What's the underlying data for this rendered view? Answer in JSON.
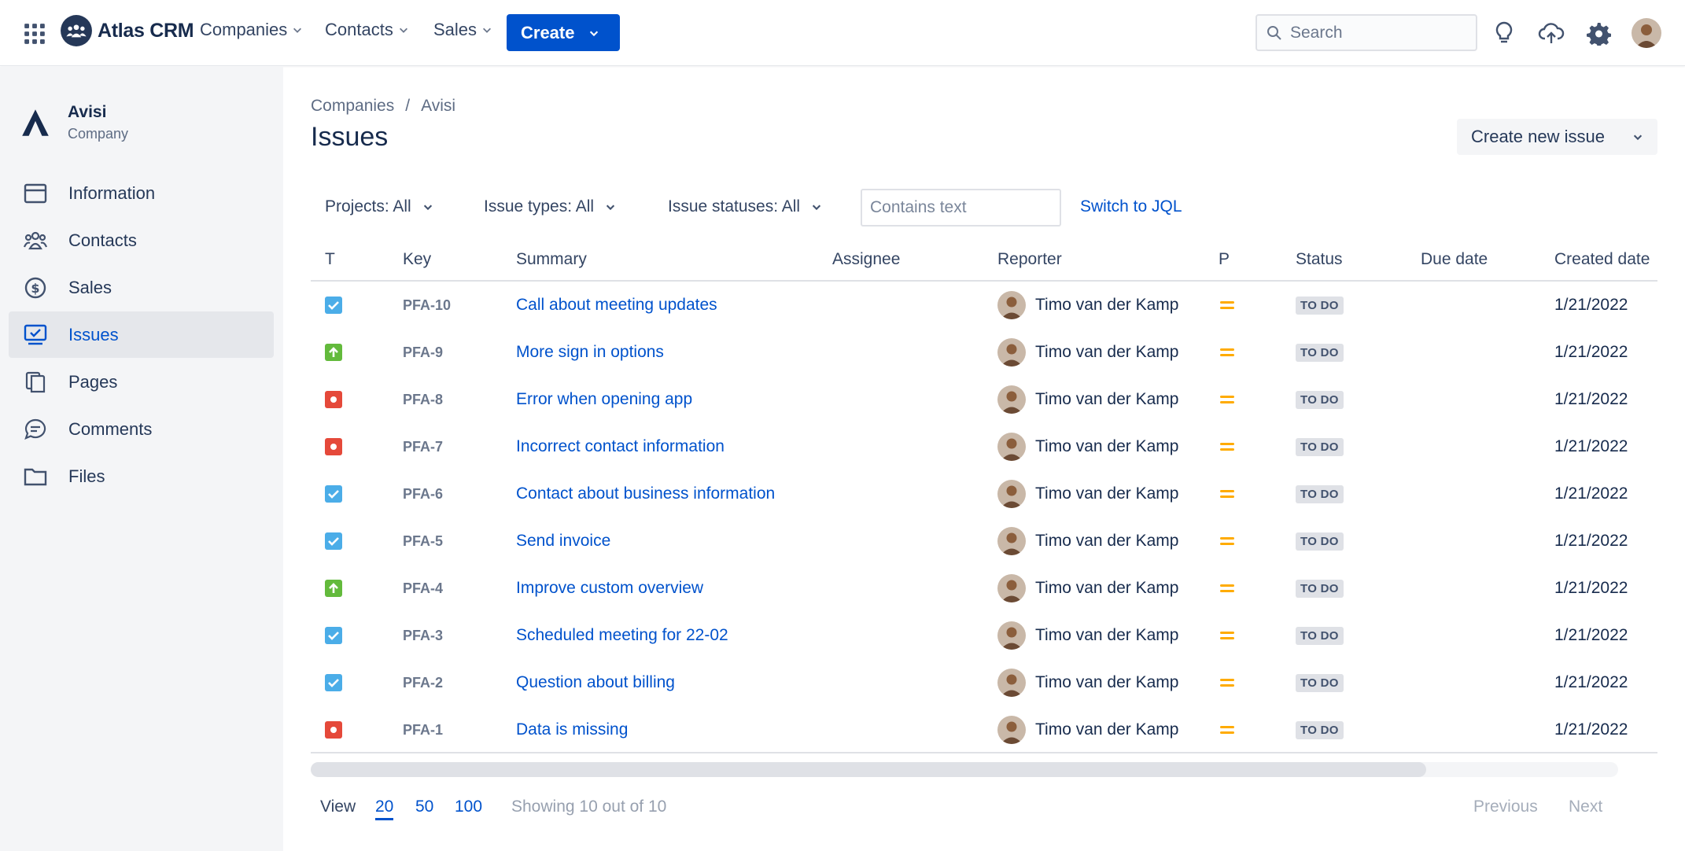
{
  "brand": {
    "name": "Atlas CRM"
  },
  "topnav": {
    "menus": [
      {
        "label": "Companies"
      },
      {
        "label": "Contacts"
      },
      {
        "label": "Sales"
      }
    ],
    "create_label": "Create",
    "search_placeholder": "Search"
  },
  "sidebar": {
    "company_name": "Avisi",
    "company_type": "Company",
    "items": [
      {
        "label": "Information",
        "icon": "browser-window-icon"
      },
      {
        "label": "Contacts",
        "icon": "people-icon"
      },
      {
        "label": "Sales",
        "icon": "dollar-circle-icon"
      },
      {
        "label": "Issues",
        "icon": "issues-monitor-icon",
        "active": true
      },
      {
        "label": "Pages",
        "icon": "pages-icon"
      },
      {
        "label": "Comments",
        "icon": "comment-icon"
      },
      {
        "label": "Files",
        "icon": "folder-icon"
      }
    ]
  },
  "breadcrumb": {
    "root": "Companies",
    "sep": "/",
    "current": "Avisi"
  },
  "page": {
    "title": "Issues",
    "create_issue_label": "Create new issue"
  },
  "filters": {
    "projects": "Projects: All",
    "issue_types": "Issue types: All",
    "issue_statuses": "Issue statuses: All",
    "text_placeholder": "Contains text",
    "jql_link": "Switch to JQL"
  },
  "table": {
    "headers": {
      "type": "T",
      "key": "Key",
      "summary": "Summary",
      "assignee": "Assignee",
      "reporter": "Reporter",
      "priority": "P",
      "status": "Status",
      "due": "Due date",
      "created": "Created date"
    },
    "rows": [
      {
        "type": "task",
        "key": "PFA-10",
        "summary": "Call about meeting updates",
        "assignee": "",
        "reporter": "Timo van der Kamp",
        "status": "TO DO",
        "due": "",
        "created": "1/21/2022"
      },
      {
        "type": "improvement",
        "key": "PFA-9",
        "summary": "More sign in options",
        "assignee": "",
        "reporter": "Timo van der Kamp",
        "status": "TO DO",
        "due": "",
        "created": "1/21/2022"
      },
      {
        "type": "bug",
        "key": "PFA-8",
        "summary": "Error when opening app",
        "assignee": "",
        "reporter": "Timo van der Kamp",
        "status": "TO DO",
        "due": "",
        "created": "1/21/2022"
      },
      {
        "type": "bug",
        "key": "PFA-7",
        "summary": "Incorrect contact information",
        "assignee": "",
        "reporter": "Timo van der Kamp",
        "status": "TO DO",
        "due": "",
        "created": "1/21/2022"
      },
      {
        "type": "task",
        "key": "PFA-6",
        "summary": "Contact about business information",
        "assignee": "",
        "reporter": "Timo van der Kamp",
        "status": "TO DO",
        "due": "",
        "created": "1/21/2022"
      },
      {
        "type": "task",
        "key": "PFA-5",
        "summary": "Send invoice",
        "assignee": "",
        "reporter": "Timo van der Kamp",
        "status": "TO DO",
        "due": "",
        "created": "1/21/2022"
      },
      {
        "type": "improvement",
        "key": "PFA-4",
        "summary": "Improve custom overview",
        "assignee": "",
        "reporter": "Timo van der Kamp",
        "status": "TO DO",
        "due": "",
        "created": "1/21/2022"
      },
      {
        "type": "task",
        "key": "PFA-3",
        "summary": "Scheduled meeting for 22-02",
        "assignee": "",
        "reporter": "Timo van der Kamp",
        "status": "TO DO",
        "due": "",
        "created": "1/21/2022"
      },
      {
        "type": "task",
        "key": "PFA-2",
        "summary": "Question about billing",
        "assignee": "",
        "reporter": "Timo van der Kamp",
        "status": "TO DO",
        "due": "",
        "created": "1/21/2022"
      },
      {
        "type": "bug",
        "key": "PFA-1",
        "summary": "Data is missing",
        "assignee": "",
        "reporter": "Timo van der Kamp",
        "status": "TO DO",
        "due": "",
        "created": "1/21/2022"
      }
    ]
  },
  "pagination": {
    "view_label": "View",
    "sizes": [
      "20",
      "50",
      "100"
    ],
    "active_size": "20",
    "showing": "Showing 10 out of 10",
    "previous": "Previous",
    "next": "Next"
  },
  "colors": {
    "primary": "#0052cc",
    "task": "#4bade8",
    "improvement": "#63ba3c",
    "bug": "#e5493a",
    "priority_medium": "#ffab00"
  }
}
